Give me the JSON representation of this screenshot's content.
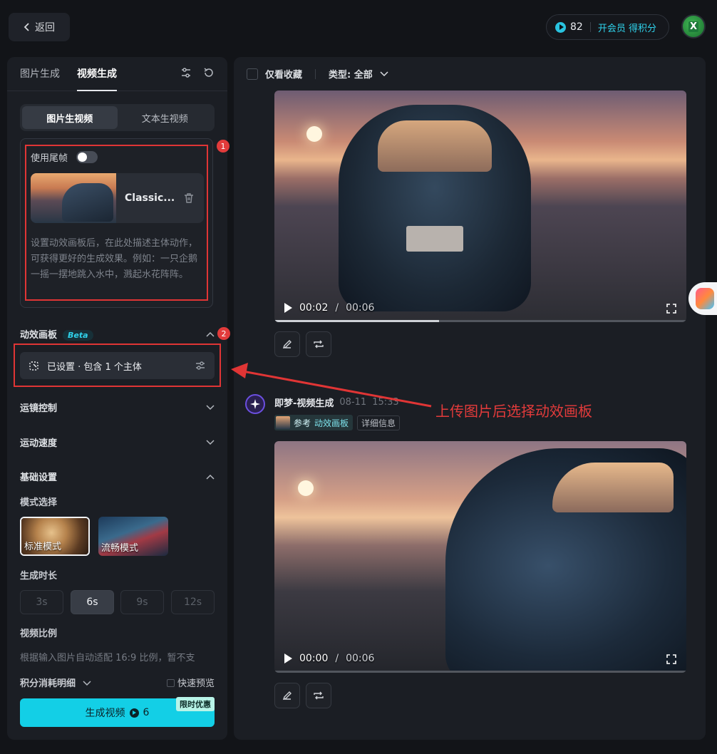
{
  "topbar": {
    "back_label": "返回",
    "credits": "82",
    "vip_label": "开会员 得积分",
    "avatar_text": "X"
  },
  "left": {
    "tabs": [
      "图片生成",
      "视频生成"
    ],
    "mode_tabs": [
      "图片生视频",
      "文本生视频"
    ],
    "use_tail_frame": "使用尾帧",
    "file_name": "Classic...",
    "hint": "设置动效画板后，在此处描述主体动作，可获得更好的生成效果。例如：一只企鹅一摇一摆地跳入水中，溅起水花阵阵。",
    "motion_board": {
      "title": "动效画板",
      "beta": "Beta",
      "value": "已设置 · 包含 1 个主体"
    },
    "camera_control": "运镜控制",
    "motion_speed": "运动速度",
    "basic_settings": "基础设置",
    "mode_select": "模式选择",
    "modes": [
      "标准模式",
      "流畅模式"
    ],
    "duration_label": "生成时长",
    "durations": [
      "3s",
      "6s",
      "9s",
      "12s"
    ],
    "selected_duration": "6s",
    "ratio_label": "视频比例",
    "ratio_note": "根据输入图片自动适配 16:9 比例，暂不支",
    "cost_detail": "积分消耗明细",
    "fast_preview": "快速预览",
    "generate": {
      "label": "生成视频",
      "cost": "6",
      "promo": "限时优惠"
    }
  },
  "right": {
    "favorites_only": "仅看收藏",
    "type_filter": "类型: 全部",
    "video1": {
      "current": "00:02",
      "separator": "/",
      "duration": "00:06",
      "progress": 0.4
    },
    "video2": {
      "current": "00:00",
      "separator": "/",
      "duration": "00:06",
      "progress": 0.0
    },
    "item_title": "即梦-视频生成",
    "item_date": "08-11",
    "item_time": "15:33",
    "tag_ref": "参考",
    "tag_board": "动效画板",
    "tag_detail": "详细信息"
  },
  "annotations": {
    "num1": "1",
    "num2": "2",
    "callout": "上传图片后选择动效画板",
    "color": "#e03535"
  }
}
